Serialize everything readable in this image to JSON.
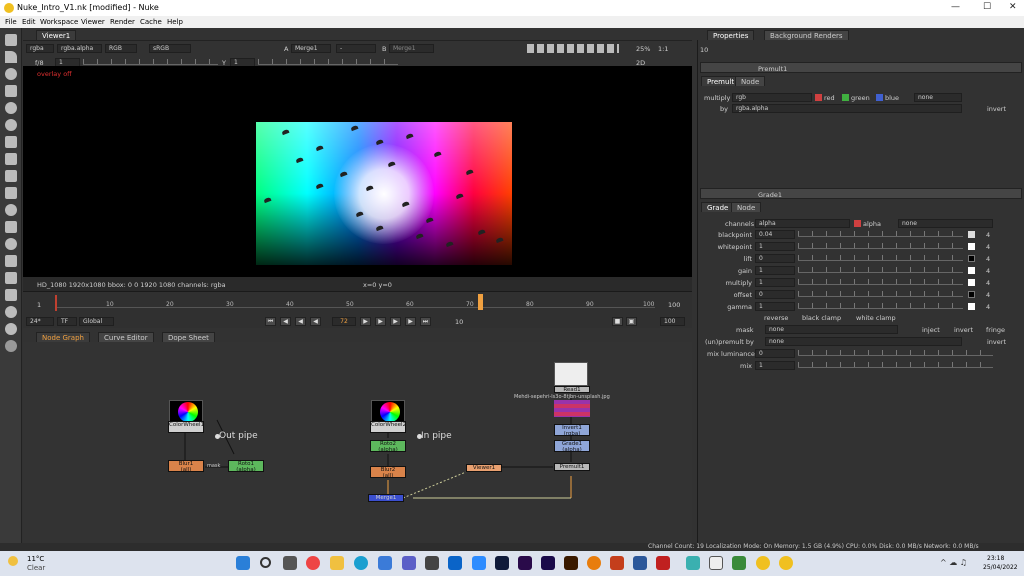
{
  "window": {
    "title": "Nuke_Intro_V1.nk [modified] - Nuke"
  },
  "menu": [
    "File",
    "Edit",
    "Workspace",
    "Viewer",
    "Render",
    "Cache",
    "Help"
  ],
  "viewer": {
    "tab": "Viewer1",
    "channels": "rgba",
    "alpha": "rgba.alpha",
    "display": "RGB",
    "lut": "sRGB",
    "input_a": "Merge1",
    "input_a_op": "-",
    "input_b": "Merge1",
    "zoom": "25%",
    "ratio": "1:1",
    "mode": "2D",
    "fstop": "f/8",
    "gain": "1",
    "y_label": "Y",
    "gamma": "1",
    "overlay": "overlay off",
    "info": "HD_1080 1920x1080  bbox: 0 0 1920 1080 channels: rgba",
    "coords": "x=0 y=0"
  },
  "timeline": {
    "start": "1",
    "end": "100",
    "end_field": "100",
    "ticks": [
      "10",
      "20",
      "30",
      "40",
      "50",
      "60",
      "70",
      "80",
      "90",
      "100"
    ],
    "current": "72",
    "fps": "24*",
    "tf": "TF",
    "global": "Global",
    "step": "10"
  },
  "bottom_tabs": [
    "Node Graph",
    "Curve Editor",
    "Dope Sheet"
  ],
  "nodes": {
    "colorwheel1": "ColorWheel1",
    "colorwheel2": "ColorWheel2",
    "blur1": "Blur1",
    "blur1_sub": "(all)",
    "roto1": "Roto1",
    "roto1_sub": "(alpha)",
    "roto2": "Roto2",
    "roto2_sub": "(alpha)",
    "blur2": "Blur2",
    "blur2_sub": "(all)",
    "merge1": "Merge1",
    "viewer1": "Viewer1",
    "read1": "Read1",
    "read1_file": "Mehdi-sepehri-ls3o-8tjbn-unsplash.jpg",
    "invert1": "Invert1",
    "invert1_sub": "(rgba)",
    "grade1": "Grade1",
    "grade1_sub": "(alpha)",
    "premult1": "Premult1",
    "out_pipe": "Out pipe",
    "in_pipe": "In pipe",
    "mask_tag": "mask",
    "a_tag": "A",
    "b_tag": "B"
  },
  "props": {
    "tabs": [
      "Properties",
      "Background Renders"
    ],
    "max_panels": "10",
    "premult": {
      "title": "Premult1",
      "tabs": [
        "Premult",
        "Node"
      ],
      "multiply_label": "multiply",
      "multiply_value": "rgb",
      "red": "red",
      "green": "green",
      "blue": "blue",
      "none": "none",
      "by_label": "by",
      "by_value": "rgba.alpha",
      "invert": "invert"
    },
    "grade": {
      "title": "Grade1",
      "tabs": [
        "Grade",
        "Node"
      ],
      "channels_label": "channels",
      "channels_value": "alpha",
      "alpha": "alpha",
      "none": "none",
      "rows": [
        {
          "label": "blackpoint",
          "value": "0.04"
        },
        {
          "label": "whitepoint",
          "value": "1"
        },
        {
          "label": "lift",
          "value": "0"
        },
        {
          "label": "gain",
          "value": "1"
        },
        {
          "label": "multiply",
          "value": "1"
        },
        {
          "label": "offset",
          "value": "0"
        },
        {
          "label": "gamma",
          "value": "1"
        }
      ],
      "reverse": "reverse",
      "black_clamp": "black clamp",
      "white_clamp": "white clamp",
      "mask_label": "mask",
      "mask_value": "none",
      "inject": "inject",
      "invert": "invert",
      "fringe": "fringe",
      "unpremult_label": "(un)premult by",
      "unpremult_value": "none",
      "invert2": "invert",
      "mixlum_label": "mix luminance",
      "mixlum_value": "0",
      "mix_label": "mix",
      "mix_value": "1",
      "num_4": "4"
    }
  },
  "status": "Channel Count: 19  Localization Mode: On  Memory: 1.5 GB (4.9%)  CPU: 0.0%  Disk: 0.0 MB/s  Network: 0.0 MB/s",
  "taskbar": {
    "temp": "11°C",
    "weather": "Clear",
    "time": "23:18",
    "date": "25/04/2022"
  },
  "colors": {
    "accent": "#f0a040",
    "node_blur": "#d9834a",
    "node_roto": "#5db85d",
    "node_merge": "#3b4fcf",
    "node_grade": "#8fa6d8",
    "node_read": "#b8b8b8"
  }
}
